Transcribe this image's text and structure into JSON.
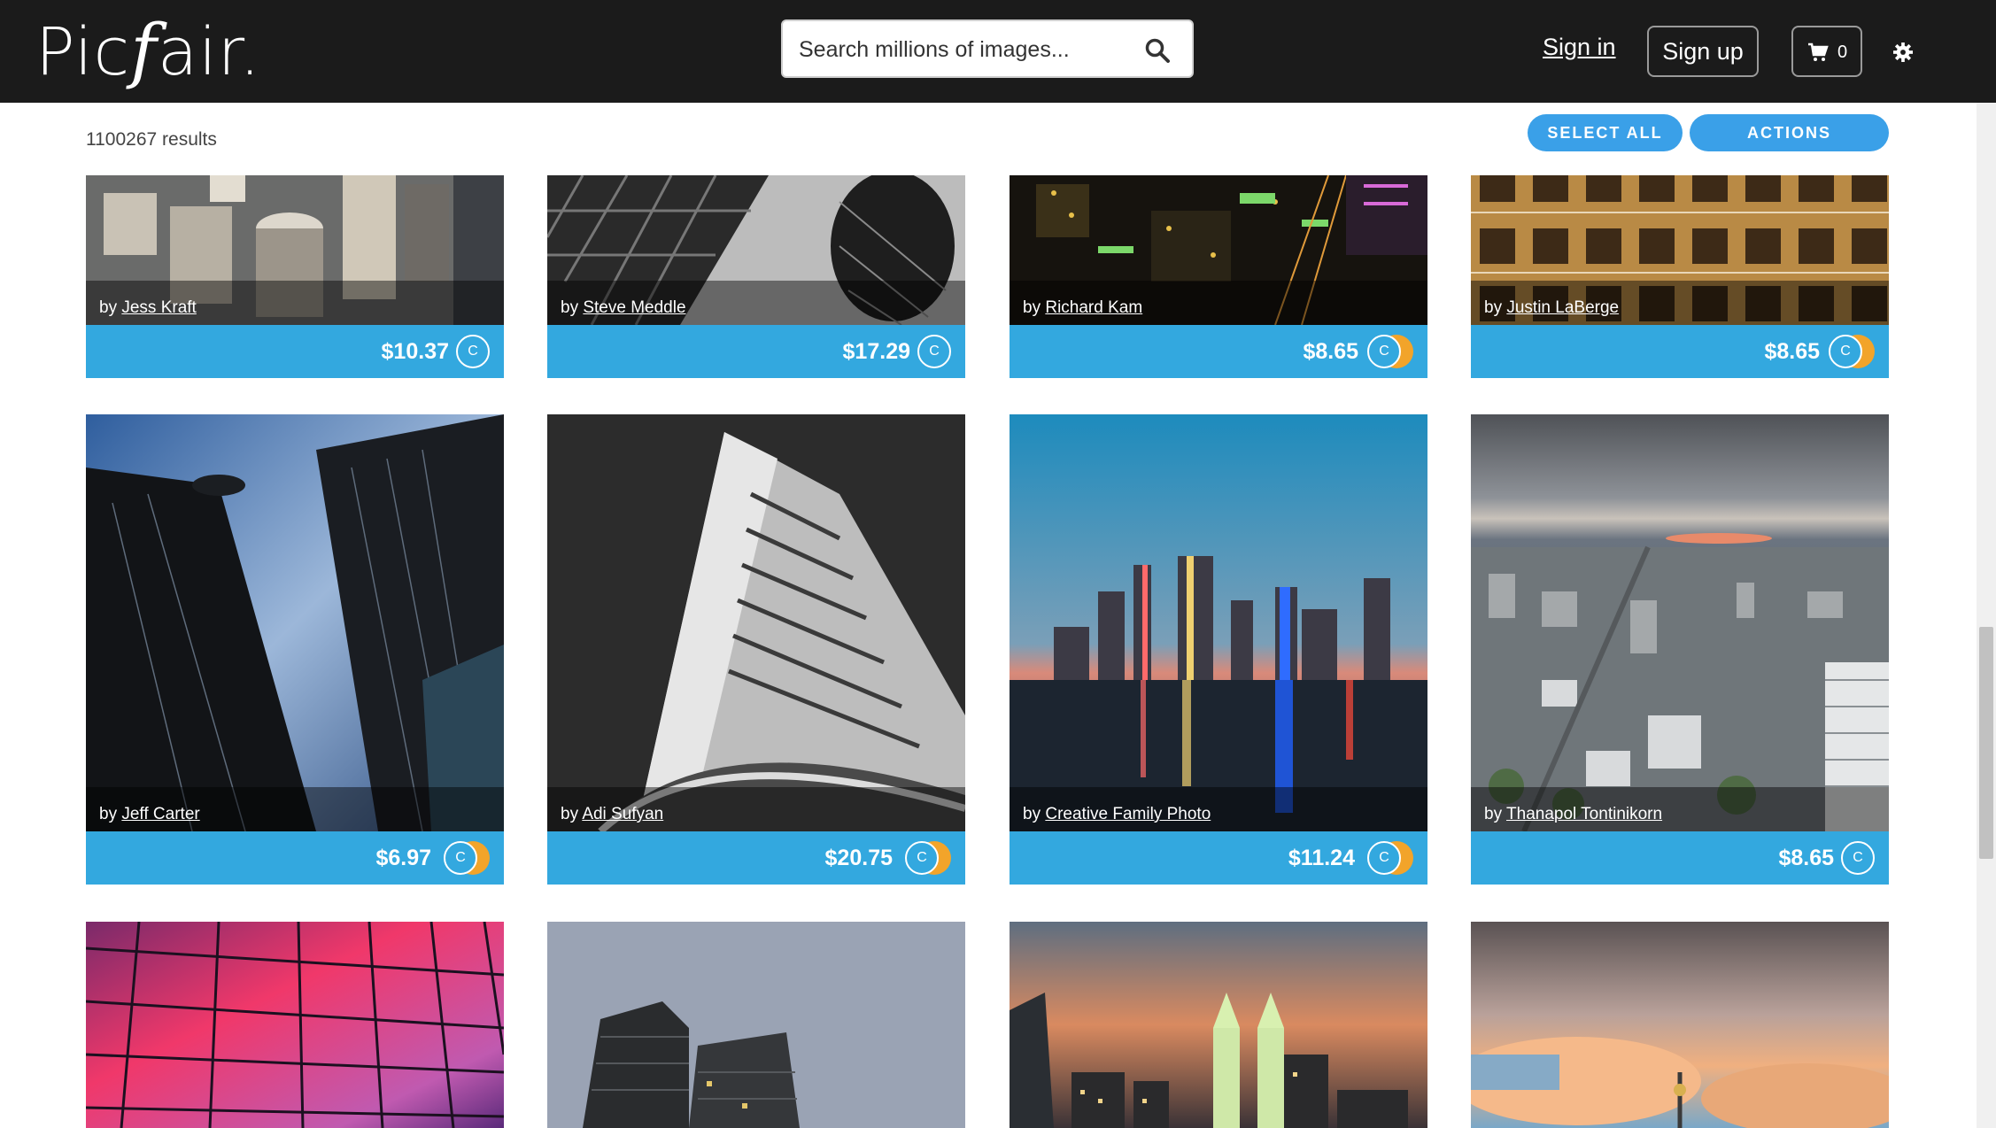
{
  "header": {
    "logo_text": "Picfair.",
    "search_placeholder": "Search millions of images...",
    "signin_label": "Sign in",
    "signup_label": "Sign up",
    "cart_count": "0",
    "icons": [
      "search-icon",
      "cart-icon",
      "gear-icon"
    ]
  },
  "toolbar": {
    "results_text": "1100267 results",
    "select_all_label": "SELECT ALL",
    "actions_label": "ACTIONS"
  },
  "colors": {
    "header_bg": "#1b1b1b",
    "accent": "#3aa0e8",
    "price_bar": "#33a8df",
    "coin_gold": "#f2a42a"
  },
  "cards": [
    {
      "prefix": "by",
      "author": "Jess Kraft",
      "price": "$10.37",
      "coin": "C",
      "double": false
    },
    {
      "prefix": "by",
      "author": "Steve Meddle",
      "price": "$17.29",
      "coin": "C",
      "double": false
    },
    {
      "prefix": "by",
      "author": "Richard Kam",
      "price": "$8.65",
      "coin": "C",
      "double": true
    },
    {
      "prefix": "by",
      "author": "Justin LaBerge",
      "price": "$8.65",
      "coin": "C",
      "double": true
    },
    {
      "prefix": "by",
      "author": "Jeff Carter",
      "price": "$6.97",
      "coin": "C",
      "double": true
    },
    {
      "prefix": "by",
      "author": "Adi Sufyan",
      "price": "$20.75",
      "coin": "C",
      "double": true
    },
    {
      "prefix": "by",
      "author": "Creative Family Photo",
      "price": "$11.24",
      "coin": "C",
      "double": true
    },
    {
      "prefix": "by",
      "author": "Thanapol Tontinikorn",
      "price": "$8.65",
      "coin": "C",
      "double": false
    }
  ]
}
